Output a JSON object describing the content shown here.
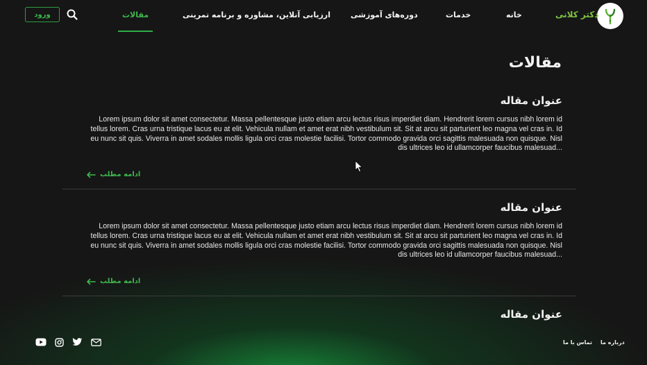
{
  "header": {
    "brand": "دکتر کلانی",
    "nav": [
      {
        "label": "خانه",
        "active": false
      },
      {
        "label": "خدمات",
        "active": false
      },
      {
        "label": "دوره‌های آموزشی",
        "active": false
      },
      {
        "label": "ارزیابی آنلاین، مشاوره و برنامه تمرینی",
        "active": false
      },
      {
        "label": "مقالات",
        "active": true
      }
    ],
    "search_icon": "search-icon",
    "login_label": "ورود"
  },
  "page_title": "مقالات",
  "articles": [
    {
      "title": "عنوان مقاله",
      "excerpt": "Lorem ipsum dolor sit amet consectetur. Massa pellentesque justo etiam arcu lectus risus imperdiet diam. Hendrerit lorem cursus nibh lorem id tellus lorem. Cras urna tristique lacus eu at elit. Vehicula nullam et amet erat nibh vestibulum sit. Sit at arcu sit parturient leo magna vel cras in. Id eu nunc sit quis. Viverra in amet sodales mollis ligula orci cras molestie facilisi. Tortor commodo gravida orci sagittis malesuada non quisque. Nisl dis ultrices leo id ullamcorper faucibus malesuad...",
      "read_more": "ادامه مطلب"
    },
    {
      "title": "عنوان مقاله",
      "excerpt": "Lorem ipsum dolor sit amet consectetur. Massa pellentesque justo etiam arcu lectus risus imperdiet diam. Hendrerit lorem cursus nibh lorem id tellus lorem. Cras urna tristique lacus eu at elit. Vehicula nullam et amet erat nibh vestibulum sit. Sit at arcu sit parturient leo magna vel cras in. Id eu nunc sit quis. Viverra in amet sodales mollis ligula orci cras molestie facilisi. Tortor commodo gravida orci sagittis malesuada non quisque. Nisl dis ultrices leo id ullamcorper faucibus malesuad...",
      "read_more": "ادامه مطلب"
    },
    {
      "title": "عنوان مقاله"
    }
  ],
  "footer": {
    "links": [
      "درباره ما",
      "تماس با ما"
    ],
    "social": [
      "youtube-icon",
      "instagram-icon",
      "twitter-icon",
      "mail-icon"
    ]
  },
  "colors": {
    "accent": "#3fb84d",
    "background": "#161616",
    "text": "#f2f2f2"
  }
}
